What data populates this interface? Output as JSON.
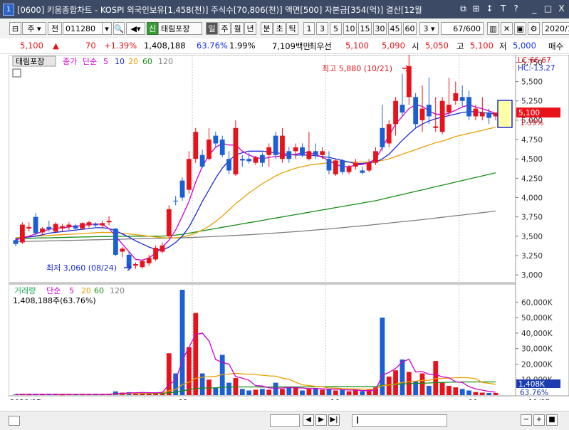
{
  "window": {
    "app_number": "1",
    "title": "[0600] 키움종합차트 - KOSPI 외국인보유[1,458(천)] 주식수[70,806(천)] 액면[500] 자본금[354(억)] 결산[12월",
    "buttons": [
      "⧉",
      "⊞",
      "↕",
      "T",
      "?",
      "_",
      "□",
      "X"
    ]
  },
  "toolbar": {
    "type_select": "주",
    "prev_label": "전",
    "code": "011280",
    "stock_name": "태림포장",
    "period_tabs": [
      "일",
      "주",
      "월",
      "년",
      "분",
      "초",
      "틱"
    ],
    "numbers": [
      "1",
      "3",
      "5",
      "10",
      "15",
      "30",
      "45",
      "60"
    ],
    "count_select": "3",
    "page_counter": "67/600",
    "date": "2020/1"
  },
  "quote": {
    "price": "5,100",
    "arrow": "▲",
    "change": "70",
    "change_pct": "+1.39%",
    "volume": "1,408,188",
    "vol_ratio": "63.76%",
    "turnover": "1.99%",
    "amount": "7,109백만",
    "pref_label": "최우선",
    "bid1": "5,100",
    "ask1": "5,090",
    "open_label": "시",
    "open": "5,050",
    "high_label": "고",
    "high": "5,100",
    "low_label": "저",
    "low": "5,000",
    "sell_label": "매수"
  },
  "chart_data": [
    {
      "type": "candlestick",
      "title": "태림포장",
      "legend": [
        "종가",
        "단순",
        "5",
        "10",
        "20",
        "60",
        "120"
      ],
      "legend_colors": [
        "#cc00cc",
        "#cc00cc",
        "#cc00cc",
        "#1a2bd6",
        "#e8a000",
        "#178f17",
        "#808080"
      ],
      "ylim": [
        2900,
        5800
      ],
      "yticks": [
        "5,750",
        "5,500",
        "5,250",
        "5,000",
        "4,750",
        "4,500",
        "4,250",
        "4,000",
        "3,750",
        "3,500",
        "3,250",
        "3,000"
      ],
      "xlabels": [
        "2020/07",
        "09",
        "10",
        "11",
        "11/05"
      ],
      "high_annotation": "최고 5,880 (10/21)",
      "low_annotation": "최저 3,060 (08/24)",
      "lc": "LC:66.67",
      "hc": "HC:-13.27",
      "price_tag": "5,100",
      "pct_tag": "1.39%",
      "candles": [
        [
          3450,
          3480,
          3370,
          3400
        ],
        [
          3420,
          3680,
          3400,
          3650
        ],
        [
          3600,
          3680,
          3560,
          3620
        ],
        [
          3750,
          3800,
          3500,
          3540
        ],
        [
          3550,
          3620,
          3520,
          3600
        ],
        [
          3620,
          3700,
          3560,
          3590
        ],
        [
          3560,
          3680,
          3540,
          3660
        ],
        [
          3600,
          3660,
          3560,
          3630
        ],
        [
          3620,
          3680,
          3580,
          3650
        ],
        [
          3640,
          3660,
          3580,
          3600
        ],
        [
          3600,
          3680,
          3580,
          3670
        ],
        [
          3640,
          3700,
          3610,
          3680
        ],
        [
          3660,
          3680,
          3620,
          3640
        ],
        [
          3640,
          3700,
          3600,
          3670
        ],
        [
          3680,
          3760,
          3640,
          3700
        ],
        [
          3600,
          3600,
          3240,
          3260
        ],
        [
          3300,
          3360,
          3230,
          3340
        ],
        [
          3260,
          3300,
          3060,
          3100
        ],
        [
          3120,
          3160,
          3080,
          3140
        ],
        [
          3100,
          3200,
          3080,
          3180
        ],
        [
          3150,
          3260,
          3120,
          3220
        ],
        [
          3200,
          3380,
          3180,
          3350
        ],
        [
          3300,
          3420,
          3280,
          3380
        ],
        [
          3500,
          3900,
          3480,
          3850
        ],
        [
          3960,
          4020,
          3900,
          3950
        ],
        [
          4220,
          4260,
          3960,
          4000
        ],
        [
          4100,
          4600,
          4050,
          4500
        ],
        [
          4500,
          4900,
          4450,
          4850
        ],
        [
          4550,
          4620,
          4380,
          4400
        ],
        [
          4500,
          4900,
          4480,
          4750
        ],
        [
          4800,
          4850,
          4650,
          4700
        ],
        [
          4750,
          4800,
          4520,
          4550
        ],
        [
          4500,
          4600,
          4300,
          4350
        ],
        [
          4300,
          5000,
          4280,
          4900
        ],
        [
          4500,
          4550,
          4400,
          4480
        ],
        [
          4500,
          4580,
          4440,
          4470
        ],
        [
          4450,
          4540,
          4420,
          4520
        ],
        [
          4550,
          4580,
          4400,
          4450
        ],
        [
          4550,
          4700,
          4400,
          4650
        ],
        [
          4800,
          4850,
          4500,
          4550
        ],
        [
          4500,
          4900,
          4450,
          4800
        ],
        [
          4600,
          4650,
          4450,
          4500
        ],
        [
          4600,
          4700,
          4500,
          4650
        ],
        [
          4650,
          4700,
          4520,
          4550
        ],
        [
          4500,
          4850,
          4480,
          4600
        ],
        [
          4600,
          4700,
          4500,
          4550
        ],
        [
          4550,
          4650,
          4500,
          4600
        ],
        [
          4500,
          4600,
          4300,
          4350
        ],
        [
          4300,
          4500,
          4280,
          4480
        ],
        [
          4480,
          4500,
          4300,
          4330
        ],
        [
          4330,
          4420,
          4300,
          4400
        ],
        [
          4400,
          4500,
          4360,
          4450
        ],
        [
          4350,
          4400,
          4300,
          4320
        ],
        [
          4350,
          4500,
          4330,
          4450
        ],
        [
          4450,
          4650,
          4420,
          4600
        ],
        [
          4900,
          5200,
          4600,
          4650
        ],
        [
          4700,
          5000,
          4650,
          4950
        ],
        [
          4950,
          5300,
          4800,
          5250
        ],
        [
          5200,
          5600,
          5050,
          5100
        ],
        [
          5300,
          5880,
          5200,
          5700
        ],
        [
          5300,
          5350,
          4900,
          4950
        ],
        [
          5000,
          5450,
          4850,
          5150
        ],
        [
          5200,
          5550,
          4950,
          5050
        ],
        [
          4900,
          5300,
          4850,
          4920
        ],
        [
          4850,
          5300,
          4820,
          5250
        ],
        [
          5100,
          5550,
          5050,
          5200
        ],
        [
          5250,
          5500,
          5200,
          5350
        ],
        [
          5300,
          5450,
          5180,
          5250
        ],
        [
          5300,
          5380,
          5000,
          5050
        ],
        [
          5050,
          5200,
          5000,
          5150
        ],
        [
          5050,
          5300,
          5000,
          5100
        ],
        [
          5100,
          5150,
          4950,
          5030
        ],
        [
          5050,
          5100,
          5000,
          5100
        ]
      ],
      "ma5": [
        3450,
        3480,
        3500,
        3530,
        3560,
        3590,
        3600,
        3610,
        3620,
        3630,
        3640,
        3650,
        3660,
        3650,
        3600,
        3500,
        3400,
        3300,
        3200,
        3190,
        3220,
        3280,
        3360,
        3450,
        3580,
        3760,
        3950,
        4200,
        4400,
        4550,
        4650,
        4700,
        4680,
        4680,
        4600,
        4550,
        4520,
        4500,
        4520,
        4530,
        4540,
        4550,
        4560,
        4580,
        4580,
        4560,
        4520,
        4480,
        4430,
        4400,
        4400,
        4420,
        4430,
        4450,
        4500,
        4650,
        4800,
        4950,
        5050,
        5150,
        5200,
        5180,
        5120,
        5080,
        5070,
        5090,
        5130,
        5170,
        5200,
        5170,
        5150,
        5120,
        5090
      ],
      "ma10": [
        3460,
        3480,
        3490,
        3500,
        3520,
        3540,
        3550,
        3560,
        3570,
        3580,
        3590,
        3600,
        3610,
        3610,
        3600,
        3570,
        3530,
        3490,
        3440,
        3400,
        3360,
        3330,
        3320,
        3360,
        3420,
        3500,
        3620,
        3780,
        3950,
        4100,
        4250,
        4380,
        4480,
        4550,
        4580,
        4600,
        4600,
        4600,
        4590,
        4580,
        4570,
        4560,
        4550,
        4550,
        4550,
        4540,
        4530,
        4520,
        4500,
        4480,
        4460,
        4440,
        4440,
        4450,
        4460,
        4500,
        4560,
        4650,
        4740,
        4820,
        4900,
        4950,
        4990,
        5020,
        5040,
        5060,
        5080,
        5100,
        5110,
        5110,
        5100,
        5090,
        5080
      ],
      "ma20": [
        3480,
        3490,
        3495,
        3500,
        3505,
        3510,
        3515,
        3520,
        3525,
        3530,
        3535,
        3540,
        3545,
        3550,
        3548,
        3545,
        3540,
        3530,
        3520,
        3510,
        3500,
        3490,
        3480,
        3480,
        3480,
        3490,
        3510,
        3540,
        3580,
        3630,
        3690,
        3760,
        3840,
        3920,
        3990,
        4060,
        4120,
        4180,
        4230,
        4280,
        4320,
        4350,
        4380,
        4400,
        4420,
        4430,
        4440,
        4450,
        4460,
        4460,
        4460,
        4460,
        4460,
        4460,
        4470,
        4480,
        4500,
        4530,
        4560,
        4590,
        4620,
        4650,
        4680,
        4710,
        4730,
        4760,
        4790,
        4810,
        4830,
        4850,
        4870,
        4890,
        4910
      ],
      "ma60": [
        3470,
        3472,
        3474,
        3476,
        3478,
        3480,
        3482,
        3484,
        3486,
        3488,
        3490,
        3492,
        3494,
        3496,
        3497,
        3498,
        3499,
        3500,
        3500,
        3500,
        3500,
        3500,
        3502,
        3508,
        3515,
        3525,
        3540,
        3555,
        3570,
        3585,
        3600,
        3615,
        3630,
        3645,
        3660,
        3675,
        3690,
        3705,
        3720,
        3735,
        3750,
        3765,
        3780,
        3795,
        3810,
        3825,
        3840,
        3855,
        3870,
        3885,
        3900,
        3915,
        3930,
        3945,
        3960,
        3980,
        4000,
        4020,
        4040,
        4060,
        4080,
        4100,
        4120,
        4140,
        4160,
        4180,
        4200,
        4220,
        4240,
        4260,
        4280,
        4300,
        4320
      ],
      "ma120": [
        3430,
        3432,
        3434,
        3436,
        3438,
        3440,
        3442,
        3444,
        3446,
        3448,
        3450,
        3452,
        3454,
        3456,
        3458,
        3460,
        3462,
        3464,
        3466,
        3468,
        3470,
        3472,
        3474,
        3476,
        3478,
        3480,
        3483,
        3486,
        3490,
        3494,
        3498,
        3502,
        3506,
        3510,
        3515,
        3520,
        3525,
        3530,
        3536,
        3542,
        3548,
        3554,
        3560,
        3567,
        3574,
        3581,
        3588,
        3595,
        3603,
        3611,
        3619,
        3627,
        3635,
        3643,
        3652,
        3661,
        3670,
        3679,
        3688,
        3697,
        3706,
        3715,
        3725,
        3735,
        3745,
        3755,
        3765,
        3775,
        3785,
        3795,
        3805,
        3815,
        3825
      ]
    },
    {
      "type": "bar",
      "title": "거래량",
      "legend": [
        "거래량",
        "단순",
        "5",
        "20",
        "60",
        "120"
      ],
      "legend_colors": [
        "#17a85a",
        "#cc00cc",
        "#cc00cc",
        "#e8a000",
        "#178f17",
        "#808080"
      ],
      "ylim": [
        0,
        68000
      ],
      "yticks": [
        "60,000K",
        "50,000K",
        "40,000K",
        "30,000K",
        "20,000K",
        "10,000K"
      ],
      "current_label": "1,408,188주(63.76%)",
      "volume_tag": "1,408K",
      "volume_pct_tag": "63.76%",
      "values": [
        500,
        600,
        450,
        700,
        500,
        600,
        550,
        400,
        500,
        450,
        600,
        500,
        450,
        600,
        700,
        2400,
        1600,
        1900,
        1200,
        1400,
        1600,
        1800,
        2000,
        27000,
        14000,
        68000,
        31000,
        53000,
        14000,
        10000,
        5000,
        26000,
        8000,
        11000,
        4000,
        3000,
        3500,
        4000,
        3500,
        8000,
        4000,
        5000,
        5000,
        3000,
        4000,
        4500,
        3500,
        4000,
        3000,
        3500,
        2500,
        3000,
        2500,
        3500,
        5000,
        50000,
        12000,
        16000,
        23000,
        15000,
        9000,
        14000,
        6000,
        22000,
        8000,
        6000,
        5000,
        4000,
        3000,
        2000,
        1600,
        1400,
        1408
      ],
      "ma5": [
        500,
        520,
        540,
        560,
        560,
        560,
        540,
        520,
        510,
        500,
        510,
        520,
        520,
        530,
        560,
        960,
        1150,
        1400,
        1560,
        1690,
        1540,
        1580,
        1680,
        6800,
        9400,
        22500,
        31000,
        39000,
        40000,
        35000,
        23000,
        21000,
        20000,
        12000,
        11000,
        9500,
        6100,
        5900,
        4700,
        4400,
        4600,
        4900,
        4800,
        4600,
        4200,
        4300,
        4100,
        3800,
        3900,
        3500,
        3300,
        3300,
        2900,
        2900,
        3300,
        12800,
        14600,
        17300,
        21300,
        23200,
        15000,
        15200,
        13400,
        13200,
        11800,
        11200,
        8600,
        8200,
        5400,
        4000,
        3200,
        2400,
        1900
      ],
      "ma20": [
        520,
        530,
        530,
        540,
        540,
        550,
        550,
        550,
        550,
        550,
        550,
        560,
        560,
        570,
        600,
        800,
        900,
        1000,
        1100,
        1200,
        1300,
        1400,
        1500,
        2800,
        3500,
        6800,
        8300,
        10900,
        11500,
        11900,
        12100,
        13300,
        13600,
        14100,
        13700,
        13500,
        13300,
        12800,
        12400,
        12200,
        11000,
        10200,
        8300,
        6600,
        6200,
        5600,
        5400,
        4600,
        4500,
        4200,
        4100,
        4000,
        3900,
        3800,
        3800,
        6100,
        6500,
        7100,
        8100,
        8700,
        9000,
        9500,
        9600,
        10600,
        10800,
        11000,
        11200,
        11300,
        11200,
        10500,
        8200,
        7600,
        7000
      ],
      "ma60": [
        600,
        600,
        600,
        600,
        600,
        600,
        600,
        600,
        600,
        600,
        600,
        600,
        600,
        600,
        600,
        700,
        800,
        900,
        950,
        1000,
        1050,
        1100,
        1150,
        1600,
        1800,
        2900,
        3400,
        4300,
        4500,
        4600,
        4700,
        5100,
        5200,
        5300,
        5300,
        5300,
        5300,
        5200,
        5200,
        5300,
        5300,
        5300,
        5300,
        5300,
        5300,
        5400,
        5400,
        5400,
        5400,
        5500,
        5500,
        5500,
        5500,
        5500,
        5600,
        6400,
        6600,
        6800,
        7200,
        7400,
        7500,
        7700,
        7800,
        8100,
        8200,
        8300,
        8400,
        8500,
        8500,
        8500,
        8500,
        8500,
        8500
      ]
    }
  ],
  "status": {
    "scroll_value": ""
  },
  "bottombar": {
    "icons": [
      "◀",
      "▶",
      "▶|",
      "−",
      "+",
      "■"
    ]
  }
}
